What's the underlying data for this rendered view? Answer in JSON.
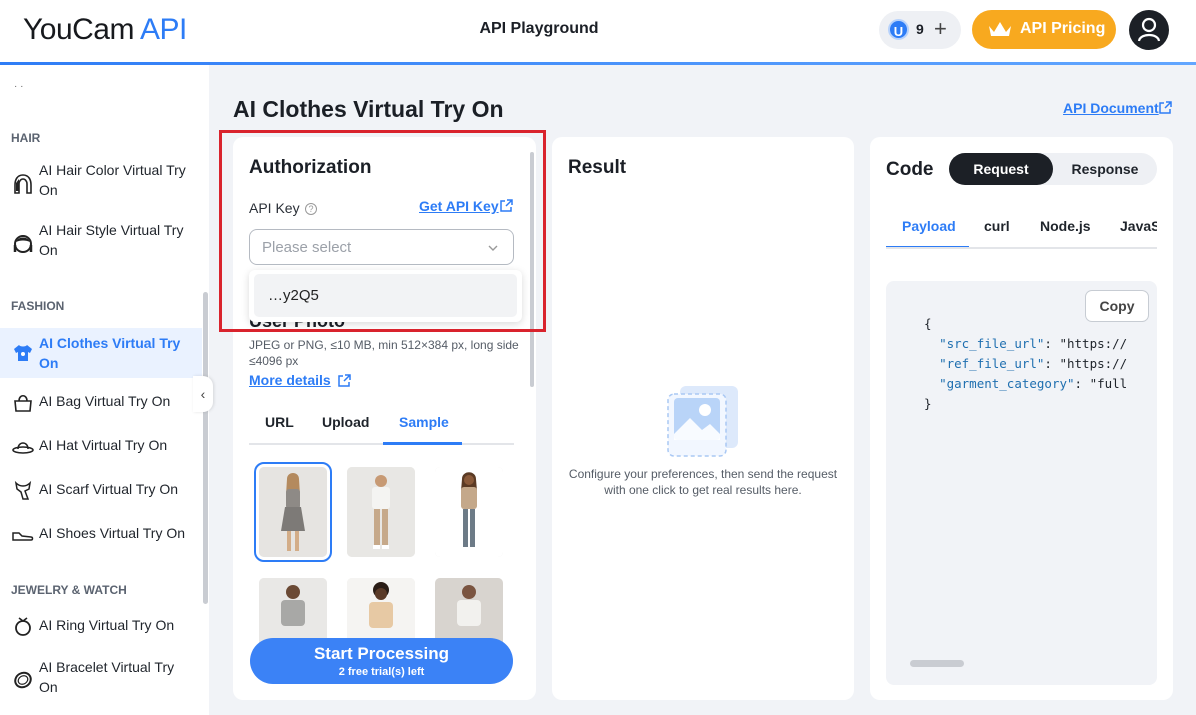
{
  "header": {
    "logo_main": "YouCam",
    "logo_accent": "API",
    "title": "API Playground",
    "credit_badge": "U",
    "credits": "9",
    "add_label": "+",
    "pricing_label": "API Pricing"
  },
  "sidebar": {
    "top_dots": "· ·",
    "sections": [
      {
        "label": "HAIR"
      },
      {
        "label": "FASHION"
      },
      {
        "label": "JEWELRY & WATCH"
      }
    ],
    "items": [
      {
        "label": "AI Hair Color Virtual Try On",
        "icon": "hair-color-icon"
      },
      {
        "label": "AI Hair Style Virtual Try On",
        "icon": "hair-style-icon"
      },
      {
        "label": "AI Clothes Virtual Try On",
        "icon": "shirt-icon"
      },
      {
        "label": "AI Bag Virtual Try On",
        "icon": "bag-icon"
      },
      {
        "label": "AI Hat Virtual Try On",
        "icon": "hat-icon"
      },
      {
        "label": "AI Scarf Virtual Try On",
        "icon": "scarf-icon"
      },
      {
        "label": "AI Shoes Virtual Try On",
        "icon": "shoe-icon"
      },
      {
        "label": "AI Ring Virtual Try On",
        "icon": "ring-icon"
      },
      {
        "label": "AI Bracelet Virtual Try On",
        "icon": "bracelet-icon"
      }
    ],
    "collapse_label": "‹"
  },
  "main": {
    "title": "AI Clothes Virtual Try On",
    "api_document": "API Document"
  },
  "auth": {
    "title": "Authorization",
    "api_key_label": "API Key",
    "help": "?",
    "get_api_key": "Get API Key",
    "select_placeholder": "Please select",
    "dropdown_option": "…y2Q5",
    "user_photo_label": "User Photo",
    "photo_desc": "JPEG or PNG, ≤10 MB, min 512×384 px, long side ≤4096 px",
    "more_details": "More details",
    "tabs": [
      "URL",
      "Upload",
      "Sample"
    ],
    "active_tab": "Sample",
    "start_label": "Start Processing",
    "trials_label": "2 free trial(s) left"
  },
  "result": {
    "title": "Result",
    "empty_text": "Configure your preferences, then send the request with one click to get real results here."
  },
  "code": {
    "title": "Code",
    "request": "Request",
    "response": "Response",
    "tabs": [
      "Payload",
      "curl",
      "Node.js",
      "JavaS"
    ],
    "active_tab": "Payload",
    "copy": "Copy",
    "lines": {
      "open": "{",
      "k1": "\"src_file_url\"",
      "v1": ": \"https://",
      "k2": "\"ref_file_url\"",
      "v2": ": \"https://",
      "k3": "\"garment_category\"",
      "v3": ": \"full",
      "close": "}"
    }
  },
  "colors": {
    "accent": "#2d7cf6",
    "pricing": "#f8a91f",
    "highlight": "#d9232d"
  }
}
